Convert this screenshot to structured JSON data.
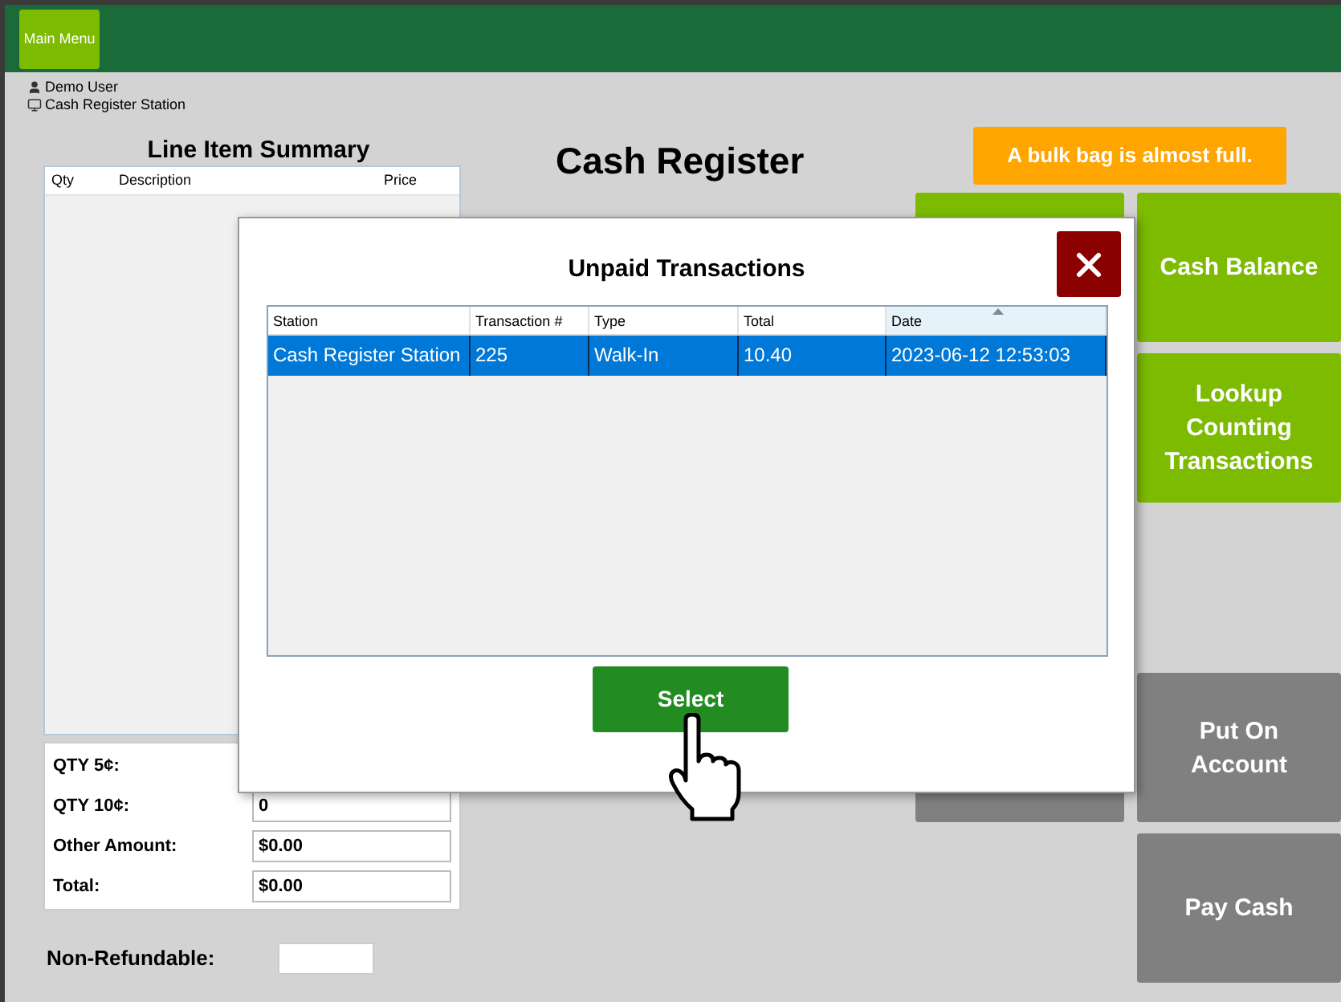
{
  "header": {
    "main_menu": "Main Menu"
  },
  "session": {
    "user": "Demo User",
    "station": "Cash Register Station"
  },
  "line_items": {
    "title": "Line Item Summary",
    "columns": [
      "Qty",
      "Description",
      "Price"
    ]
  },
  "summary": [
    {
      "label": "QTY 5¢:"
    },
    {
      "label": "QTY 10¢:",
      "value": "0"
    },
    {
      "label": "Other Amount:",
      "value": "$0.00"
    },
    {
      "label": "Total:",
      "value": "$0.00"
    }
  ],
  "non_refundable": {
    "label": "Non-Refundable:"
  },
  "title": "Cash Register",
  "alert": "A bulk bag is almost full.",
  "top_buttons": [
    {
      "label": "Cash Balance",
      "disabled": false
    },
    {
      "label": "Lookup Counting Transactions",
      "disabled": false
    }
  ],
  "bottom_buttons": [
    {
      "disabled": true
    },
    {
      "label": "Put On Account",
      "disabled": true
    },
    {
      "label": "Pay Cash",
      "disabled": true
    }
  ],
  "dialog": {
    "title": "Unpaid Transactions",
    "columns": [
      {
        "label": "Station",
        "sorted": false
      },
      {
        "label": "Transaction #",
        "sorted": false
      },
      {
        "label": "Type",
        "sorted": false
      },
      {
        "label": "Total",
        "sorted": false
      },
      {
        "label": "Date",
        "sorted": true
      }
    ],
    "rows": [
      {
        "cells": [
          "Cash Register Station",
          "225",
          "Walk-In",
          "10.40",
          "2023-06-12 12:53:03"
        ],
        "selected": true
      }
    ],
    "select_button": "Select"
  }
}
